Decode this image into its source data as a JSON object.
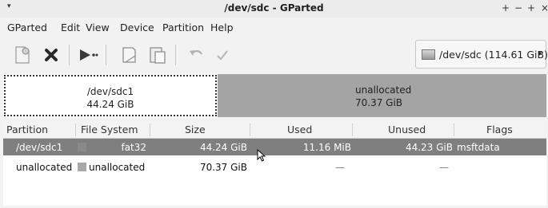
{
  "window": {
    "title": "/dev/sdc - GParted",
    "menu_arrow": "▾",
    "controls": [
      "+",
      "−",
      "+",
      "×"
    ]
  },
  "menubar": {
    "items": [
      "GParted",
      "Edit",
      "View",
      "Device",
      "Partition",
      "Help"
    ]
  },
  "toolbar": {
    "buttons": [
      "new",
      "delete",
      "resize-move",
      "copy",
      "paste",
      "undo",
      "apply"
    ]
  },
  "device_selector": {
    "label": "/dev/sdc (114.61 GiB)",
    "caret": "▾",
    "icon": "drive-icon"
  },
  "partition_map": {
    "segments": [
      {
        "name": "/dev/sdc1",
        "size": "44.24 GiB",
        "selected": true,
        "color": "#ffffff"
      },
      {
        "name": "unallocated",
        "size": "70.37 GiB",
        "selected": false,
        "color": "#a4a4a4"
      }
    ]
  },
  "table": {
    "headers": [
      "Partition",
      "File System",
      "Size",
      "Used",
      "Unused",
      "Flags"
    ],
    "rows": [
      {
        "partition": "/dev/sdc1",
        "filesystem": "fat32",
        "fs_color": "#8a8a8a",
        "size": "44.24 GiB",
        "used": "11.16 MiB",
        "unused": "44.23 GiB",
        "flags": "msftdata",
        "selected": true
      },
      {
        "partition": "unallocated",
        "filesystem": "unallocated",
        "fs_color": "#a8a8a8",
        "size": "70.37 GiB",
        "used": "—",
        "unused": "—",
        "flags": "",
        "selected": false
      }
    ]
  },
  "colors": {
    "selected_row": "#7f7f7f",
    "unallocated": "#a4a4a4",
    "background": "#f2f2f2"
  }
}
